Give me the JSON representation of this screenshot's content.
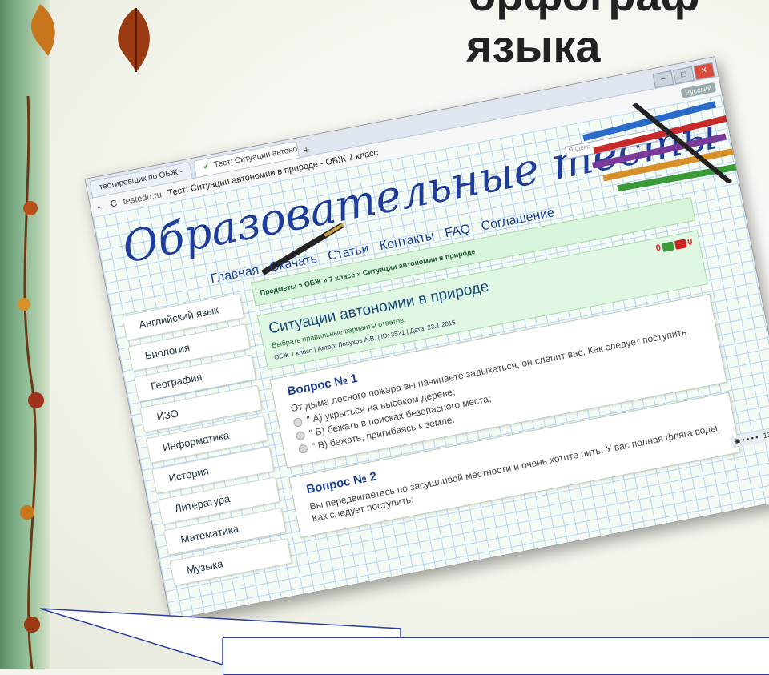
{
  "slide": {
    "title_line1": "орфограф",
    "title_line2": "языка"
  },
  "browser": {
    "tabs": [
      {
        "label": "тестировщик по ОБЖ -",
        "active": false
      },
      {
        "label": "Тест: Ситуации автоно",
        "active": true
      }
    ],
    "new_tab_symbol": "+",
    "url": "testedu.ru",
    "page_title": "Тест: Ситуации автономии в природе - ОБЖ 7 класс",
    "language_badge": "Русский",
    "window_controls": {
      "minimize": "–",
      "maximize": "□",
      "close": "✕"
    }
  },
  "site": {
    "title": "Образовательные тесты",
    "search_placeholder": "Яндекс",
    "nav": [
      "Главная",
      "Скачать",
      "Статьи",
      "Контакты",
      "FAQ",
      "Соглашение"
    ],
    "sidebar": [
      "Английский язык",
      "Биология",
      "География",
      "ИЗО",
      "Информатика",
      "История",
      "Литература",
      "Математика",
      "Музыка"
    ],
    "breadcrumb": "Предметы » ОБЖ » 7 класс » Ситуации автономии в природе",
    "test": {
      "title": "Ситуации автономии в природе",
      "instruction": "Выбрать правильные варианты ответов.",
      "meta": "ОБЖ 7 класс | Автор: Лопухов А.В. | ID: 3521 | Дата: 23.1.2015",
      "score_up": "0",
      "score_down": "0"
    },
    "questions": [
      {
        "heading": "Вопрос № 1",
        "text": "От дыма лесного пожара вы начинаете задыхаться, он слепит вас. Как следует поступить",
        "options": [
          "\" А) укрыться на высоком дереве;",
          "\" Б) бежать в поисках безопасного места;",
          "\" В) бежать, пригибаясь к земле."
        ]
      },
      {
        "heading": "Вопрос № 2",
        "text": "Вы передвигаетесь по засушливой местности и очень хотите пить. У вас полная фляга воды. Как следует поступить:",
        "options": []
      }
    ],
    "taskbar_time": "13:44"
  },
  "colors": {
    "site_title": "#1e3c9a",
    "nav_link": "#1a3f96",
    "breadcrumb_bg": "#d8f5dc",
    "grid_line": "#b9d5f2",
    "callout_border": "#2a3f9a"
  }
}
